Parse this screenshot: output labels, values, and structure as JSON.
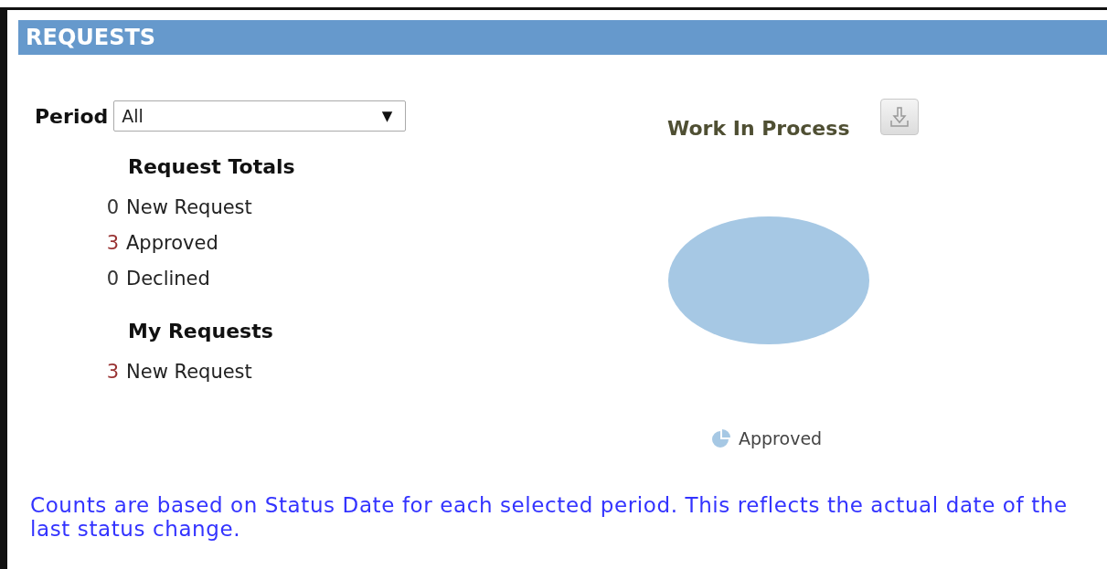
{
  "panel": {
    "title": "REQUESTS"
  },
  "period": {
    "label": "Period",
    "value": "All",
    "caret": "▼"
  },
  "groups": [
    {
      "title": "Request Totals",
      "items": [
        {
          "count": "0",
          "label": "New Request",
          "color": "#333333"
        },
        {
          "count": "3",
          "label": "Approved",
          "color": "#993333"
        },
        {
          "count": "0",
          "label": "Declined",
          "color": "#333333"
        }
      ]
    },
    {
      "title": "My Requests",
      "items": [
        {
          "count": "3",
          "label": "New Request",
          "color": "#993333"
        }
      ]
    }
  ],
  "chart": {
    "chart_data": {
      "type": "pie",
      "title": "Work In Process",
      "series": [
        {
          "name": "Approved",
          "color": "#a6c8e4",
          "values": [
            100
          ]
        }
      ]
    }
  },
  "note": "Counts are based on Status Date for each selected period. This reflects the actual date of the last status change."
}
